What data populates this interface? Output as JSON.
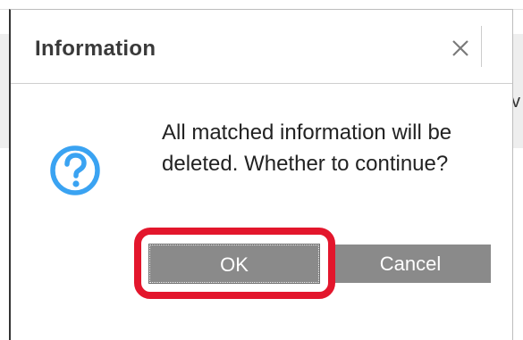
{
  "dialog": {
    "title": "Information",
    "close_icon": "close-icon",
    "message": "All matched information will be deleted. Whether to continue?",
    "icon": "question-icon",
    "ok_label": "OK",
    "cancel_label": "Cancel"
  },
  "background": {
    "cut_text": "v"
  },
  "colors": {
    "icon_blue": "#3aa3f2",
    "button_gray": "#8a8a8a",
    "highlight_red": "#e3162c"
  }
}
